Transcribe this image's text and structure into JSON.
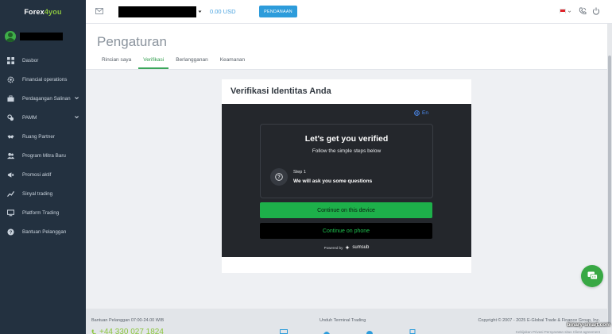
{
  "brand": {
    "name_part1": "Forex",
    "name_part2": "4you"
  },
  "sidebar": {
    "items": [
      {
        "label": "Dasbor",
        "icon": "grid-icon"
      },
      {
        "label": "Financial operations",
        "icon": "settings-icon"
      },
      {
        "label": "Perdagangan Salinan",
        "icon": "briefcase-icon",
        "expandable": true
      },
      {
        "label": "PAMM",
        "icon": "pamm-icon",
        "expandable": true
      },
      {
        "label": "Ruang Partner",
        "icon": "handshake-icon"
      },
      {
        "label": "Program Mitra Baru",
        "icon": "users-icon"
      },
      {
        "label": "Promosi aktif",
        "icon": "megaphone-icon"
      },
      {
        "label": "Sinyal trading",
        "icon": "chart-line-icon"
      },
      {
        "label": "Platform Trading",
        "icon": "monitor-icon"
      },
      {
        "label": "Bantuan Pelanggan",
        "icon": "help-icon"
      }
    ]
  },
  "topbar": {
    "balance": "0.00 USD",
    "deposit_label": "PENDANAAN"
  },
  "page": {
    "title": "Pengaturan",
    "tabs": [
      {
        "label": "Rincian saya",
        "active": false
      },
      {
        "label": "Verifikasi",
        "active": true
      },
      {
        "label": "Berlangganan",
        "active": false
      },
      {
        "label": "Keamanan",
        "active": false
      }
    ]
  },
  "verification": {
    "card_title": "Verifikasi Identitas Anda",
    "language": "En",
    "heading": "Let's get you verified",
    "subheading": "Follow the simple steps below",
    "step_label": "Step 1",
    "step_text": "We will ask you some questions",
    "primary_button": "Continue on this device",
    "secondary_button": "Continue on phone",
    "powered_by": "Powered by",
    "provider": "sumsub"
  },
  "footer": {
    "support_hours": "Bantuan Pelanggan 07:00-24.00 WIB",
    "phone": "+44 330 027 1824",
    "download_label": "Unduh Terminal Trading",
    "copyright": "Copyright © 2007 - 2025 E-Global Trade & Finance Group, Inc.",
    "links": "Kebijakan Privasi   Persyaratan situs   Client agreement"
  },
  "watermark": "binary-smart.com",
  "colors": {
    "sidebar_bg": "#233140",
    "accent_green": "#3aa65a",
    "deposit_blue": "#2d9cdb",
    "widget_bg": "#24272c"
  }
}
